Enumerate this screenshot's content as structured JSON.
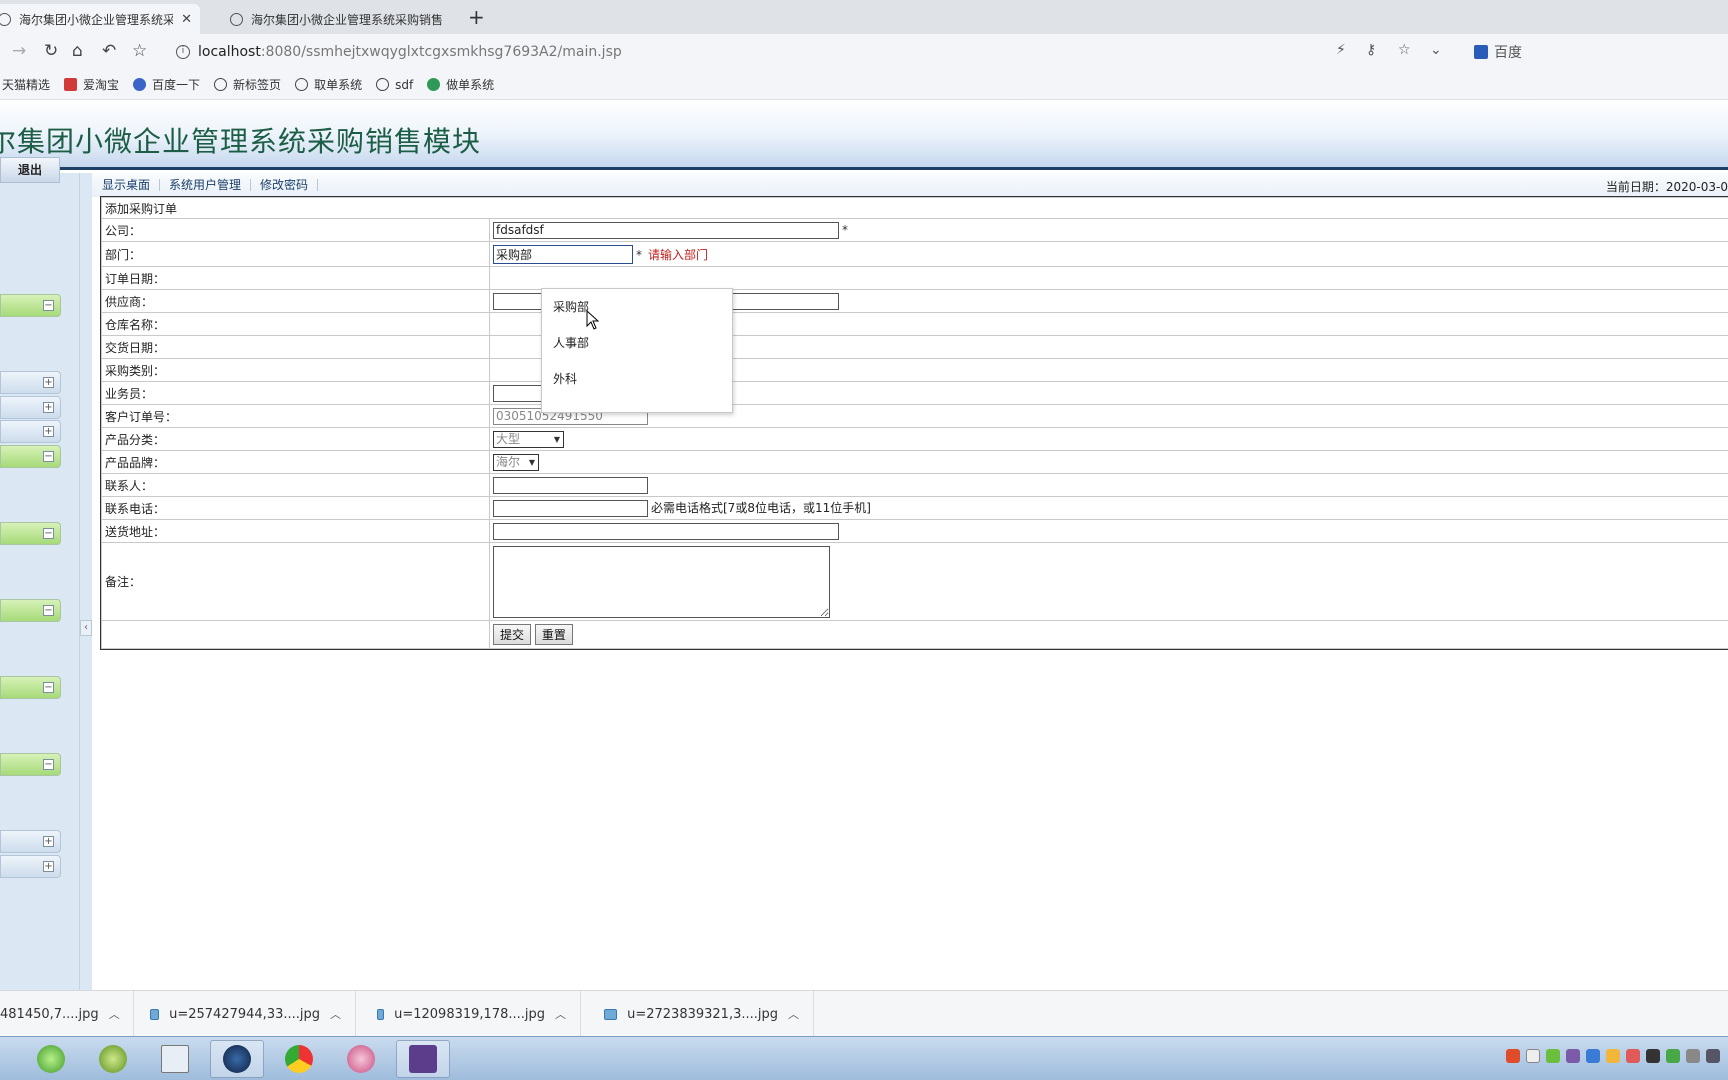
{
  "browser": {
    "tabs": [
      {
        "title": "海尔集团小微企业管理系统采购",
        "active": true
      },
      {
        "title": "海尔集团小微企业管理系统采购销售",
        "active": false
      }
    ],
    "url_host": "localhost",
    "url_rest": ":8080/ssmhejtxwqyglxtcgxsmkhsg7693A2/main.jsp",
    "search_engine": "百度",
    "bookmarks": [
      "天猫精选",
      "爱淘宝",
      "百度一下",
      "新标签页",
      "取单系统",
      "sdf",
      "做单系统"
    ]
  },
  "page": {
    "banner_title": "尔集团小微企业管理系统采购销售模块",
    "logout_label": "退出",
    "menu": [
      "显示桌面",
      "系统用户管理",
      "修改密码"
    ],
    "current_date": "当前日期：2020-03-0"
  },
  "form": {
    "title": "添加采购订单",
    "company_label": "公司：",
    "company_value": "fdsafdsf",
    "dept_label": "部门：",
    "dept_value": "采购部",
    "dept_error": "请输入部门",
    "order_date_label": "订单日期：",
    "supplier_label": "供应商：",
    "warehouse_label": "仓库名称：",
    "delivery_date_label": "交货日期：",
    "category_label": "采购类别：",
    "salesman_label": "业务员：",
    "customer_order_label": "客户订单号：",
    "customer_order_value": "03051052491550",
    "product_class_label": "产品分类：",
    "product_class_value": "大型",
    "brand_label": "产品品牌：",
    "brand_value": "海尔",
    "contact_label": "联系人：",
    "phone_label": "联系电话：",
    "phone_hint": "必需电话格式[7或8位电话，或11位手机]",
    "address_label": "送货地址：",
    "remark_label": "备注：",
    "submit_label": "提交",
    "reset_label": "重置",
    "required_mark": "*"
  },
  "dept_dropdown": {
    "options": [
      "采购部",
      "人事部",
      "外科"
    ],
    "hovered": "采购部"
  },
  "downloads": [
    "481450,7....jpg",
    "u=257427944,33....jpg",
    "u=12098319,178....jpg",
    "u=2723839321,3....jpg"
  ],
  "colors": {
    "banner_text": "#1c5d45",
    "banner_border": "#1e3f66",
    "sidebar_green": "#a6da78",
    "error_red": "#c0201c",
    "menu_link": "#1a3f6a"
  }
}
